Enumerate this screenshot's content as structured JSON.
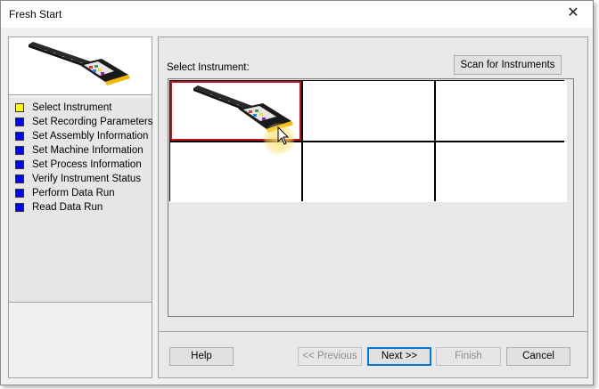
{
  "window": {
    "title": "Fresh Start"
  },
  "steps": [
    {
      "label": "Select Instrument",
      "color": "#ffff00"
    },
    {
      "label": "Set Recording Parameters",
      "color": "#0000ff"
    },
    {
      "label": "Set Assembly Information",
      "color": "#0000ff"
    },
    {
      "label": "Set Machine Information",
      "color": "#0000ff"
    },
    {
      "label": "Set Process Information",
      "color": "#0000ff"
    },
    {
      "label": "Verify Instrument Status",
      "color": "#0000ff"
    },
    {
      "label": "Perform Data Run",
      "color": "#0000ff"
    },
    {
      "label": "Read Data Run",
      "color": "#0000ff"
    }
  ],
  "main": {
    "select_label": "Select Instrument:",
    "scan_button": "Scan for Instruments",
    "selected_color": "#c0161b"
  },
  "footer": {
    "help": "Help",
    "previous": "<< Previous",
    "next": "Next >>",
    "finish": "Finish",
    "cancel": "Cancel"
  },
  "icons": {
    "close": "close-icon",
    "instrument": "instrument-probe-icon",
    "cursor": "mouse-pointer-icon"
  }
}
